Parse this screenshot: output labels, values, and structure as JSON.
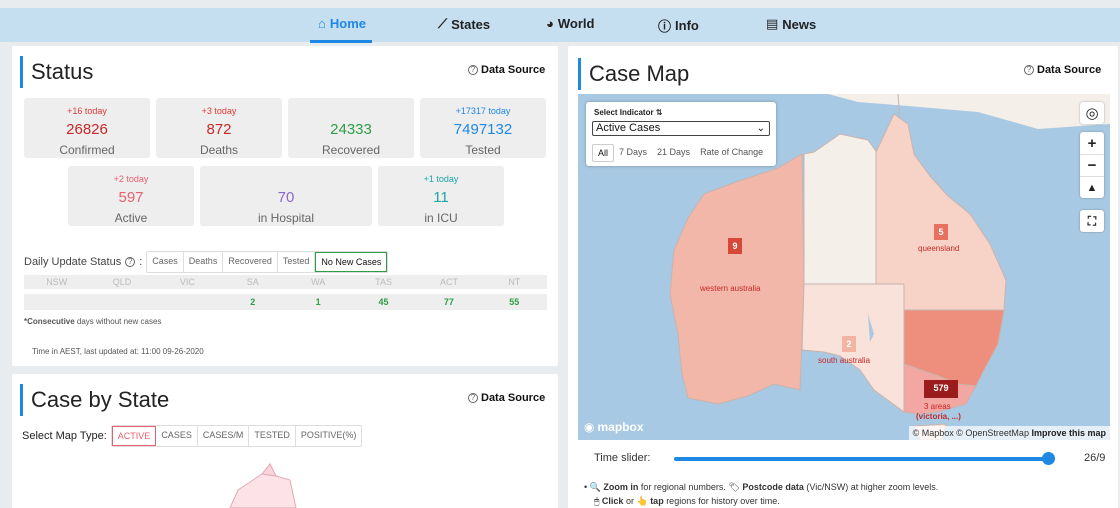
{
  "nav": {
    "items": [
      {
        "label": "Home",
        "icon": "home-icon",
        "glyph": "⌂"
      },
      {
        "label": "States",
        "icon": "chart-icon",
        "glyph": "⟋"
      },
      {
        "label": "World",
        "icon": "globe-icon",
        "glyph": "◕"
      },
      {
        "label": "Info",
        "icon": "info-icon",
        "glyph": "ⓘ"
      },
      {
        "label": "News",
        "icon": "news-icon",
        "glyph": "▤"
      }
    ],
    "active": "Home"
  },
  "status": {
    "title": "Status",
    "data_source": "Data Source",
    "tiles": {
      "confirmed": {
        "today": "+16 today",
        "value": "26826",
        "label": "Confirmed"
      },
      "deaths": {
        "today": "+3 today",
        "value": "872",
        "label": "Deaths"
      },
      "recovered": {
        "today": "",
        "value": "24333",
        "label": "Recovered"
      },
      "tested": {
        "today": "+17317 today",
        "value": "7497132",
        "label": "Tested"
      },
      "active": {
        "today": "+2 today",
        "value": "597",
        "label": "Active"
      },
      "hospital": {
        "today": "",
        "value": "70",
        "label": "in Hospital"
      },
      "icu": {
        "today": "+1 today",
        "value": "11",
        "label": "in ICU"
      }
    },
    "daily_update": {
      "label": "Daily Update Status",
      "options": [
        "Cases",
        "Deaths",
        "Recovered",
        "Tested",
        "No New Cases"
      ],
      "selected": "No New Cases"
    },
    "states": [
      "NSW",
      "QLD",
      "VIC",
      "SA",
      "WA",
      "TAS",
      "ACT",
      "NT"
    ],
    "state_values": [
      "",
      "",
      "",
      "2",
      "1",
      "45",
      "77",
      "55"
    ],
    "consecutive_strong": "*Consecutive",
    "consecutive_rest": " days without new cases",
    "updated": "Time in AEST, last updated at: 11:00 09-26-2020"
  },
  "case_by_state": {
    "title": "Case by State",
    "data_source": "Data Source",
    "map_type_label": "Select Map Type:",
    "map_types": [
      "ACTIVE",
      "CASES",
      "CASES/M",
      "TESTED",
      "POSITIVE(%)"
    ],
    "selected": "ACTIVE"
  },
  "case_map": {
    "title": "Case Map",
    "data_source": "Data Source",
    "indicator_label": "Select Indicator",
    "indicator_value": "Active Cases",
    "ranges": [
      "All",
      "7 Days",
      "21 Days",
      "Rate of Change"
    ],
    "selected_range": "All",
    "regions": [
      {
        "name": "queensland",
        "count": "5"
      },
      {
        "name": "western australia",
        "count": "9"
      },
      {
        "name": "south australia",
        "count": "2"
      },
      {
        "name": "3 areas",
        "sub": "(victoria, ...)",
        "count": "579"
      }
    ],
    "logo": "mapbox",
    "attribution": "© Mapbox © OpenStreetMap",
    "improve": "Improve this map"
  },
  "slider": {
    "label": "Time slider:",
    "value": "26/9",
    "progress": 1.0
  },
  "tips": {
    "zoom_strong": "Zoom in",
    "zoom_rest": " for regional numbers.",
    "postcode_strong": "Postcode data",
    "postcode_rest": " (Vic/NSW) at higher zoom levels.",
    "click_strong": "Click",
    "or": " or ",
    "tap_strong": "tap",
    "click_rest": " regions for history over time."
  }
}
